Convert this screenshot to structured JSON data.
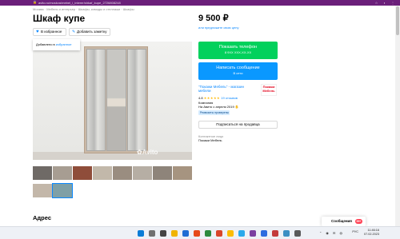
{
  "browser": {
    "url": "avito.ru/moskva/mebel_i_interer/shkaf_kupe_2726808248"
  },
  "breadcrumb": "Москва · Мебель и интерьер · Шкафы, комоды и стеллажи · Шкафы",
  "title": "Шкаф купе",
  "price": {
    "value": "9 500 ₽",
    "sub": "или предложите свою цену"
  },
  "actions": {
    "favorite": "В избранное",
    "note": "Добавить заметку"
  },
  "tooltip": {
    "text": "Добавлено в",
    "link": "избранное"
  },
  "photo": {
    "watermark": "Avito"
  },
  "contact": {
    "phone_title": "Показать телефон",
    "phone_masked": "8 9ХХ ХХХ-ХХ-ХХ",
    "message_title": "Написать сообщение",
    "message_sub": "В сети"
  },
  "seller": {
    "name": "\"Покажи Мебель\" - магазин мебели",
    "logo_text": "Покажи Мебель",
    "rating": "4.8",
    "stars": "★★★★★",
    "reviews": "19 отзывов",
    "type": "Компания",
    "since": "На Авито с апреля 2019",
    "badge": "Реквизиты проверены",
    "subscribe": "Подписаться на продавца",
    "contact_label": "Контактное лицо",
    "contact_name": "Покажи Мебель"
  },
  "sections": {
    "address": "Адрес"
  },
  "messages": {
    "label": "Сообщения",
    "count": "99+"
  },
  "taskbar": {
    "lang": "РУС",
    "time": "11:46:16",
    "date": "07.02.2023"
  },
  "colors": {
    "chrome": "#6b1f7a",
    "phone_button": "#02d15c",
    "message_button": "#0a98ff",
    "link": "#0a88ff"
  }
}
